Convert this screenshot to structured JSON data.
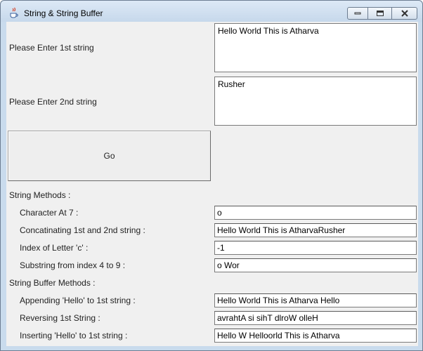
{
  "window": {
    "title": "String & String Buffer",
    "icon": "java-cup-icon"
  },
  "inputs": {
    "first_label": "Please Enter 1st string",
    "first_value": "Hello World This is Atharva",
    "second_label": "Please Enter 2nd string",
    "second_value": "Rusher"
  },
  "go_button": "Go",
  "string_methods": {
    "heading": "String Methods :",
    "rows": [
      {
        "label": "Character At 7 :",
        "value": "o"
      },
      {
        "label": "Concatinating 1st and 2nd string :",
        "value": "Hello World This is AtharvaRusher"
      },
      {
        "label": "Index of Letter 'c' :",
        "value": "-1"
      },
      {
        "label": "Substring from index 4 to 9 :",
        "value": "o Wor"
      }
    ]
  },
  "buffer_methods": {
    "heading": "String Buffer Methods :",
    "rows": [
      {
        "label": "Appending 'Hello' to 1st string :",
        "value": "Hello World This is Atharva Hello"
      },
      {
        "label": "Reversing 1st String :",
        "value": "avrahtA si sihT dlroW olleH"
      },
      {
        "label": "Inserting 'Hello' to 1st string :",
        "value": "Hello W Helloorld This is Atharva"
      }
    ]
  },
  "colors": {
    "titlebar": "#c9dbed",
    "panel": "#f0f0f0",
    "field_border": "#7a7a7a"
  }
}
